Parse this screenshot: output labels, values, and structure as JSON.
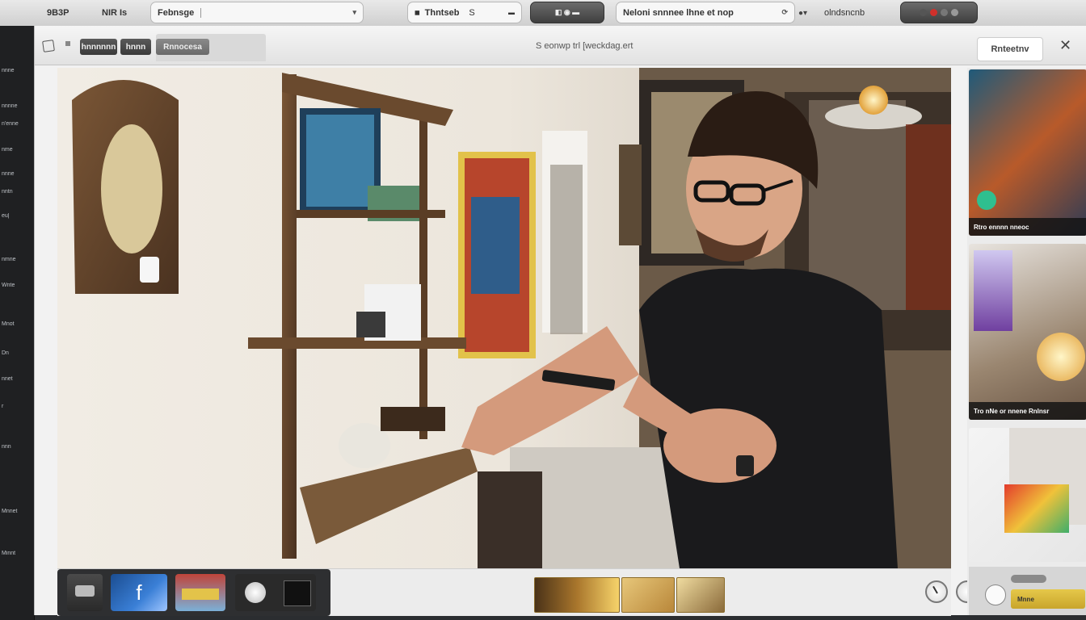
{
  "topbar": {
    "left_1": "9B3P",
    "left_2": "NIR Is",
    "search_value": "Febnsge",
    "tab_pill": "Thntseb",
    "tab_pill_suffix": "S",
    "address_value": "Neloni snnnee lhne et nop",
    "right_text": "olndsncnb"
  },
  "toolbar": {
    "btn_1": "hnnnnnn",
    "btn_2": "hnnn",
    "btn_3": "Rnnocesa",
    "center_title": "S eonwp trl [weckdag.ert",
    "right_button": "Rnteetnv",
    "close": "✕"
  },
  "sidebar": {
    "items": [
      "nnne",
      "nnnne",
      "n'enne",
      "nme",
      "nnne",
      "nntn",
      "eu|",
      "nmne",
      "Wnte",
      "Mnot",
      "Dn",
      "nnet",
      "r",
      "nnn",
      "Mnnet",
      "Minnt"
    ]
  },
  "right_panel": {
    "card_1_label": "Rtro ennnn nneoc",
    "card_2_label": "Tro nNe or nnene  Rnlnsr",
    "bottom_label": "Mnne"
  },
  "colors": {
    "accent_green": "#2fbf8f",
    "toolbar_dark": "#3a3a3a",
    "record_red": "#d0302b"
  },
  "icons": {
    "sidebar_toggle": "square-icon",
    "knob_1": "dial-icon",
    "knob_2": "dial-icon"
  }
}
